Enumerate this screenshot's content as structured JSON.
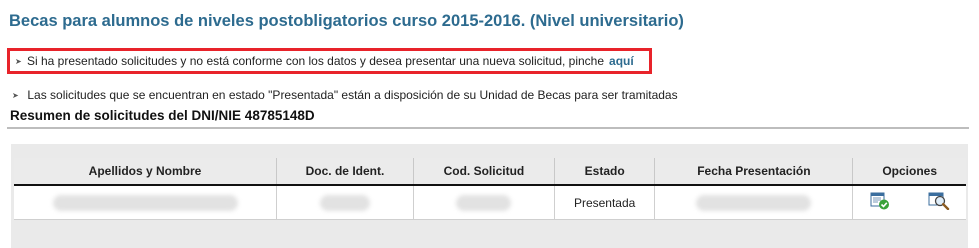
{
  "page": {
    "title": "Becas para alumnos de niveles postobligatorios curso 2015-2016.  (Nivel universitario)"
  },
  "notice": {
    "text": "Si ha presentado solicitudes y no está conforme con los datos y desea presentar una nueva solicitud, pinche",
    "link_label": "aquí"
  },
  "info": {
    "text": "Las solicitudes que se encuentran en estado \"Presentada\" están a disposición de su Unidad de Becas para ser tramitadas"
  },
  "summary": {
    "title": "Resumen de solicitudes del DNI/NIE 48785148D"
  },
  "table": {
    "columns": [
      "Apellidos y Nombre",
      "Doc. de Ident.",
      "Cod. Solicitud",
      "Estado",
      "Fecha Presentación",
      "Opciones"
    ],
    "rows": [
      {
        "estado": "Presentada"
      }
    ]
  },
  "icons": {
    "bullet": "arrow-right-icon",
    "option_1": "document-check-icon",
    "option_2": "magnifier-icon"
  },
  "colors": {
    "title": "#2d6b8f",
    "notice_border": "#e8232a",
    "header_rule": "#111111"
  }
}
